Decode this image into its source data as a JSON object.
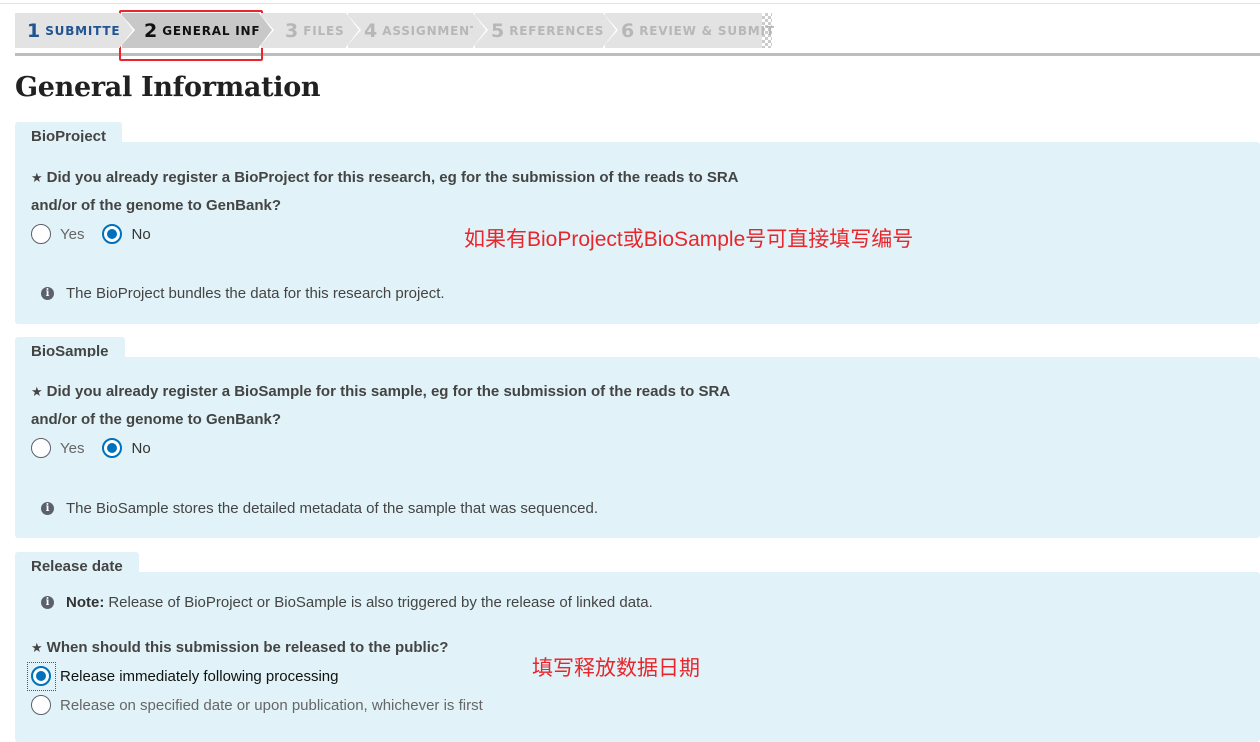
{
  "steps": [
    {
      "num": "1",
      "label": "SUBMITTER"
    },
    {
      "num": "2",
      "label": "GENERAL INFO"
    },
    {
      "num": "3",
      "label": "FILES"
    },
    {
      "num": "4",
      "label": "ASSIGNMENT"
    },
    {
      "num": "5",
      "label": "REFERENCES"
    },
    {
      "num": "6",
      "label": "REVIEW & SUBMIT"
    }
  ],
  "page_title": "General Information",
  "bioproject": {
    "tab": "BioProject",
    "question_line1": "Did you already register a BioProject for this research, eg for the submission of the reads to SRA",
    "question_line2": "and/or of the genome to GenBank?",
    "yes": "Yes",
    "no": "No",
    "selected": "No",
    "info": "The BioProject bundles the data for this research project.",
    "annotation": "如果有BioProject或BioSample号可直接填写编号"
  },
  "biosample": {
    "tab": "BioSample",
    "question_line1": "Did you already register a BioSample for this sample, eg for the submission of the reads to SRA",
    "question_line2": "and/or of the genome to GenBank?",
    "yes": "Yes",
    "no": "No",
    "selected": "No",
    "info": "The BioSample stores the detailed metadata of the sample that was sequenced."
  },
  "release": {
    "tab": "Release date",
    "note_label": "Note:",
    "note_text": "Release of BioProject or BioSample is also triggered by the release of linked data.",
    "question": "When should this submission be released to the public?",
    "option_immediate": "Release immediately following processing",
    "option_specified": "Release on specified date or upon publication, whichever is first",
    "selected": "immediate",
    "annotation": "填写释放数据日期"
  },
  "colors": {
    "accent": "#0071bc",
    "panel": "#e1f3f8",
    "annotation_red": "#e8262b",
    "step_done": "#205493"
  },
  "icons": [
    "info-icon",
    "required-star-icon",
    "radio-checked",
    "radio-unchecked"
  ]
}
